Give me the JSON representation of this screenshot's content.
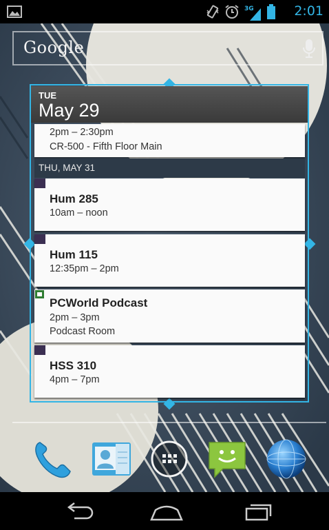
{
  "status_bar": {
    "time": "2:01",
    "network_type": "3G",
    "icons": [
      "picture-notification-icon",
      "vibrate-icon",
      "alarm-icon",
      "signal-icon",
      "battery-icon"
    ],
    "accent": "#33b5e5"
  },
  "search": {
    "logo": "Google",
    "mic_icon": "microphone-icon"
  },
  "calendar_widget": {
    "header": {
      "day_of_week": "TUE",
      "date": "May 29"
    },
    "first_event": {
      "time": "2pm – 2:30pm",
      "location": "CR-500 - Fifth Floor Main"
    },
    "day_divider": "THU, MAY 31",
    "events": [
      {
        "title": "Hum 285",
        "time": "10am – noon",
        "location": "",
        "chip": "filled"
      },
      {
        "title": "Hum 115",
        "time": "12:35pm – 2pm",
        "location": "",
        "chip": "filled"
      },
      {
        "title": "PCWorld Podcast",
        "time": "2pm – 3pm",
        "location": "Podcast Room",
        "chip": "hollow"
      },
      {
        "title": "HSS 310",
        "time": "4pm – 7pm",
        "location": "",
        "chip": "filled"
      }
    ],
    "resize_frame_color": "#33b5e5"
  },
  "dock": {
    "items": [
      "phone-icon",
      "contacts-icon",
      "app-drawer-icon",
      "messaging-icon",
      "browser-icon"
    ]
  },
  "nav_bar": {
    "buttons": [
      "back-icon",
      "home-icon",
      "recent-apps-icon"
    ]
  }
}
